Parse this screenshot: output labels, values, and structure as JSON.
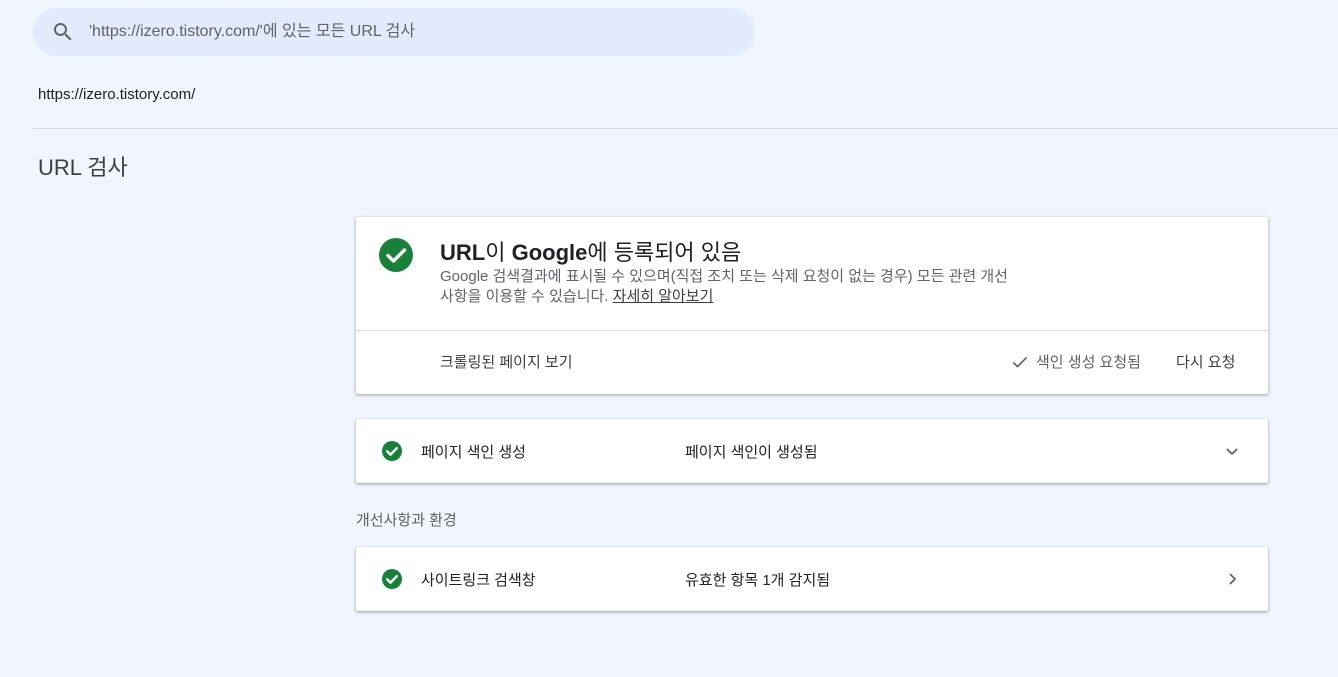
{
  "search": {
    "placeholder": "'https://izero.tistory.com/'에 있는 모든 URL 검사"
  },
  "property": {
    "url": "https://izero.tistory.com/"
  },
  "page": {
    "title": "URL 검사"
  },
  "status_card": {
    "heading_part1": "URL",
    "heading_part2": "이 ",
    "heading_part3": "Google",
    "heading_part4": "에 등록되어 있음",
    "description": "Google 검색결과에 표시될 수 있으며(직접 조치 또는 삭제 요청이 없는 경우) 모든 관련 개선사항을 이용할 수 있습니다. ",
    "learn_more": "자세히 알아보기",
    "crawled_page_label": "크롤링된 페이지 보기",
    "indexing_requested": "색인 생성 요청됨",
    "request_again": "다시 요청"
  },
  "indexing_row": {
    "label": "페이지 색인 생성",
    "value": "페이지 색인이 생성됨"
  },
  "enhancements": {
    "section_label": "개선사항과 환경",
    "items": [
      {
        "label": "사이트링크 검색창",
        "value": "유효한 항목 1개 감지됨"
      }
    ]
  },
  "colors": {
    "success": "#188038",
    "background": "#f1f5fd",
    "search_bg": "#e2ebfb"
  },
  "icons": {
    "search": "search-icon",
    "check_circle": "check-circle-icon",
    "check": "check-icon",
    "chevron_down": "chevron-down-icon",
    "chevron_right": "chevron-right-icon"
  }
}
